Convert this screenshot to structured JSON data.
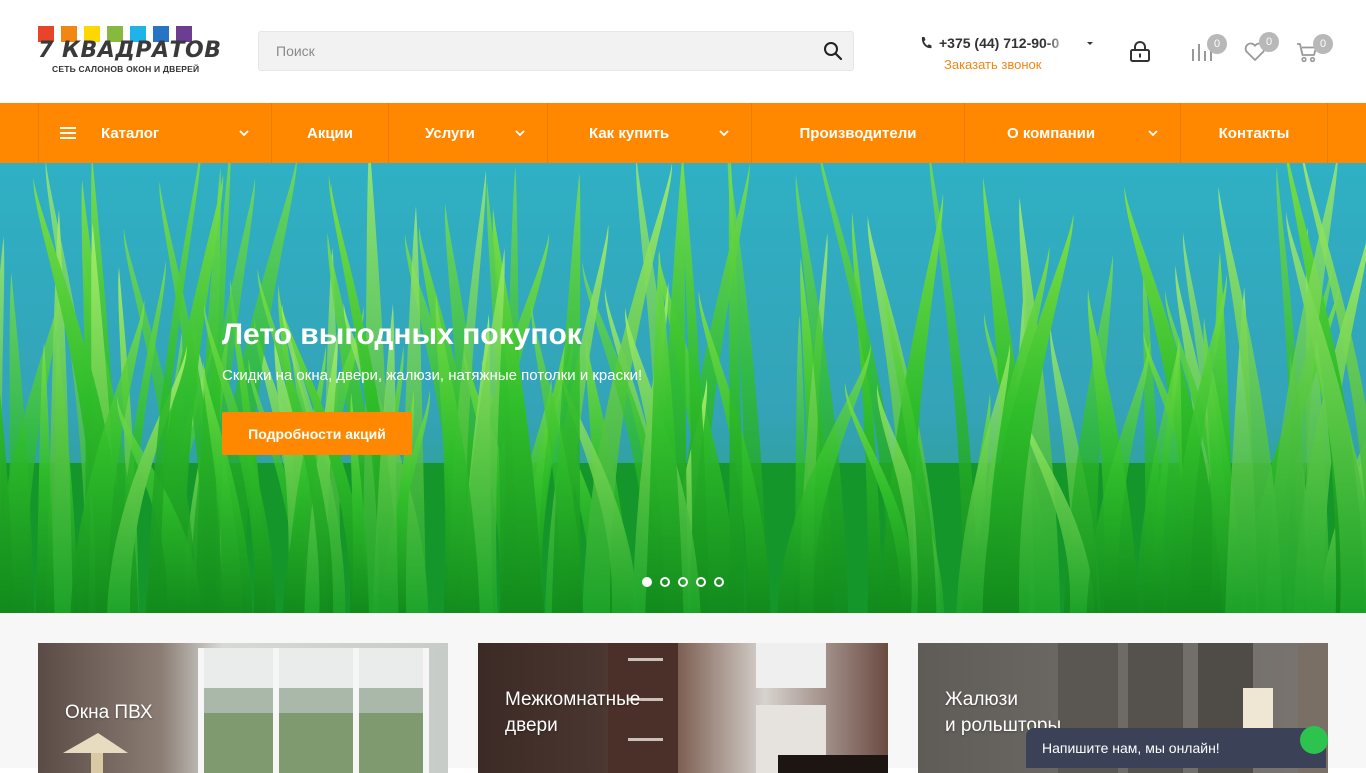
{
  "logo": {
    "squares": [
      "#e8442a",
      "#f28613",
      "#fed700",
      "#86b93d",
      "#1fb3e8",
      "#2874c4",
      "#6c3d91"
    ],
    "word": "7 КВАДРАТОВ",
    "tagline": "СЕТЬ САЛОНОВ ОКОН И ДВЕРЕЙ"
  },
  "search": {
    "placeholder": "Поиск",
    "icon": "search-icon"
  },
  "contact": {
    "phone": "+375 (44) 712-90-0",
    "callback_label": "Заказать звонок"
  },
  "header_icons": {
    "login": {
      "icon": "lock-icon"
    },
    "compare": {
      "icon": "compare-icon",
      "count": "0"
    },
    "favorites": {
      "icon": "heart-icon",
      "count": "0"
    },
    "cart": {
      "icon": "cart-icon",
      "count": "0"
    }
  },
  "nav": {
    "items": [
      {
        "label": "Каталог",
        "has_menu": true
      },
      {
        "label": "Акции",
        "has_menu": false
      },
      {
        "label": "Услуги",
        "has_menu": true
      },
      {
        "label": "Как купить",
        "has_menu": true
      },
      {
        "label": "Производители",
        "has_menu": false
      },
      {
        "label": "О компании",
        "has_menu": true
      },
      {
        "label": "Контакты",
        "has_menu": false
      }
    ]
  },
  "banner": {
    "title": "Лето выгодных покупок",
    "subtitle": "Скидки на окна, двери, жалюзи, натяжные потолки и краски!",
    "button_label": "Подробности акций",
    "slide_count": 5,
    "active_slide": 1
  },
  "categories": [
    {
      "line1": "Окна ПВХ",
      "line2": ""
    },
    {
      "line1": "Межкомнатные",
      "line2": "двери"
    },
    {
      "line1": "Жалюзи",
      "line2": "и рольшторы"
    }
  ],
  "chat": {
    "label": "Напишите нам, мы онлайн!"
  },
  "colors": {
    "accent": "#ff8800",
    "link": "#f28613",
    "badge": "#b8b8b8"
  }
}
